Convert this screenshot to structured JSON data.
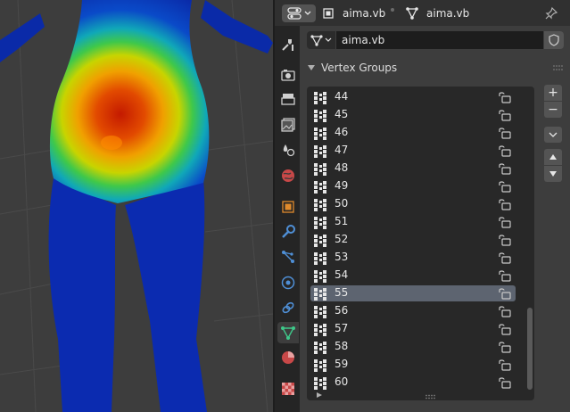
{
  "header": {
    "mesh_label": "aima.vb",
    "object_data_label": "aima.vb"
  },
  "context": {
    "name": "aima.vb"
  },
  "panel": {
    "title": "Vertex Groups"
  },
  "vertex_groups": {
    "selected": "55",
    "items": [
      "44",
      "45",
      "46",
      "47",
      "48",
      "49",
      "50",
      "51",
      "52",
      "53",
      "54",
      "55",
      "56",
      "57",
      "58",
      "59",
      "60"
    ]
  },
  "tabs": [
    "tool",
    "render",
    "output",
    "view-layer",
    "scene",
    "world",
    "object",
    "modifiers",
    "particles",
    "physics",
    "constraints",
    "object-data",
    "material",
    "texture"
  ],
  "active_tab": "object-data",
  "side_buttons": {
    "add": "+",
    "remove": "−"
  }
}
